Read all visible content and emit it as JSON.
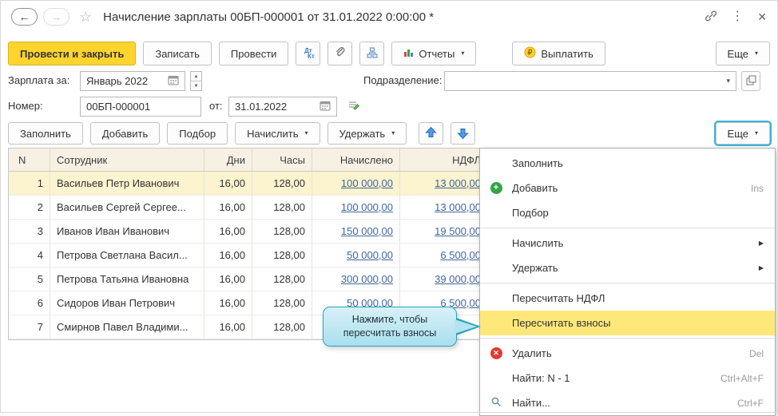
{
  "window": {
    "title": "Начисление зарплаты 00БП-000001 от 31.01.2022 0:00:00 *"
  },
  "icons": {
    "back": "←",
    "forward": "→",
    "favorite": "☆",
    "kebab": "⋮",
    "close": "✕",
    "caret_down": "▾",
    "submenu": "▶",
    "spin_up": "▲",
    "spin_down": "▼",
    "add_glyph": "+",
    "delete_glyph": "✕"
  },
  "toolbar": {
    "post_and_close": "Провести и закрыть",
    "save": "Записать",
    "post": "Провести",
    "dt": "Дт",
    "kt": "Кт",
    "reports": "Отчеты",
    "pay": "Выплатить",
    "more": "Еще"
  },
  "fields": {
    "salary_for_label": "Зарплата за:",
    "salary_for_value": "Январь 2022",
    "department_label": "Подразделение:",
    "department_value": "",
    "number_label": "Номер:",
    "number_value": "00БП-000001",
    "date_label": "от:",
    "date_value": "31.01.2022"
  },
  "table_toolbar": {
    "fill": "Заполнить",
    "add": "Добавить",
    "pick": "Подбор",
    "accrue": "Начислить",
    "withhold": "Удержать",
    "more": "Еще"
  },
  "table": {
    "headers": {
      "n": "N",
      "employee": "Сотрудник",
      "days": "Дни",
      "hours": "Часы",
      "accrued": "Начислено",
      "ndfl": "НДФЛ"
    },
    "rows": [
      {
        "n": "1",
        "employee": "Васильев Петр Иванович",
        "days": "16,00",
        "hours": "128,00",
        "accrued": "100 000,00",
        "ndfl": "13 000,00"
      },
      {
        "n": "2",
        "employee": "Васильев Сергей Сергее...",
        "days": "16,00",
        "hours": "128,00",
        "accrued": "100 000,00",
        "ndfl": "13 000,00"
      },
      {
        "n": "3",
        "employee": "Иванов Иван Иванович",
        "days": "16,00",
        "hours": "128,00",
        "accrued": "150 000,00",
        "ndfl": "19 500,00"
      },
      {
        "n": "4",
        "employee": "Петрова Светлана Васил...",
        "days": "16,00",
        "hours": "128,00",
        "accrued": "50 000,00",
        "ndfl": "6 500,00"
      },
      {
        "n": "5",
        "employee": "Петрова Татьяна Ивановна",
        "days": "16,00",
        "hours": "128,00",
        "accrued": "300 000,00",
        "ndfl": "39 000,00"
      },
      {
        "n": "6",
        "employee": "Сидоров Иван Петрович",
        "days": "16,00",
        "hours": "128,00",
        "accrued": "50 000,00",
        "ndfl": "6 500,00"
      },
      {
        "n": "7",
        "employee": "Смирнов Павел Владими...",
        "days": "16,00",
        "hours": "128,00",
        "accrued": "",
        "ndfl": ""
      }
    ]
  },
  "tooltip": {
    "text": "Нажмите, чтобы пересчитать взносы"
  },
  "context_menu": {
    "items": [
      {
        "label": "Заполнить"
      },
      {
        "label": "Добавить",
        "shortcut": "Ins"
      },
      {
        "label": "Подбор"
      },
      {
        "label": "Начислить"
      },
      {
        "label": "Удержать"
      },
      {
        "label": "Пересчитать НДФЛ"
      },
      {
        "label": "Пересчитать взносы"
      },
      {
        "label": "Удалить",
        "shortcut": "Del"
      },
      {
        "label": "Найти: N - 1",
        "shortcut": "Ctrl+Alt+F"
      },
      {
        "label": "Найти...",
        "shortcut": "Ctrl+F"
      }
    ]
  }
}
